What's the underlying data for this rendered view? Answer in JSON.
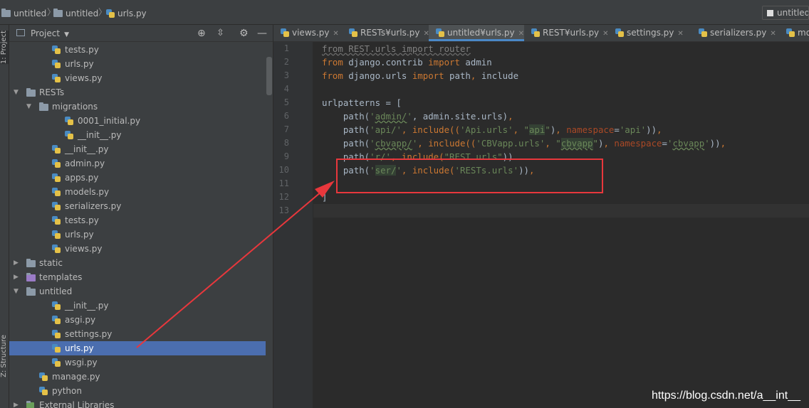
{
  "navbar": {
    "crumbs": [
      "untitled",
      "untitled",
      "urls.py"
    ],
    "run_config": "untitled"
  },
  "toolstrip": {
    "project_tab": "1: Project",
    "structure_tab": "Z: Structure"
  },
  "project_panel": {
    "title": "Project",
    "tree": [
      {
        "label": "tests.py",
        "type": "py"
      },
      {
        "label": "urls.py",
        "type": "py"
      },
      {
        "label": "views.py",
        "type": "py"
      },
      {
        "label": "RESTs",
        "type": "folder",
        "expanded": true
      },
      {
        "label": "migrations",
        "type": "folder",
        "expanded": true
      },
      {
        "label": "0001_initial.py",
        "type": "py"
      },
      {
        "label": "__init__.py",
        "type": "py"
      },
      {
        "label": "__init__.py",
        "type": "py"
      },
      {
        "label": "admin.py",
        "type": "py"
      },
      {
        "label": "apps.py",
        "type": "py"
      },
      {
        "label": "models.py",
        "type": "py"
      },
      {
        "label": "serializers.py",
        "type": "py"
      },
      {
        "label": "tests.py",
        "type": "py"
      },
      {
        "label": "urls.py",
        "type": "py"
      },
      {
        "label": "views.py",
        "type": "py"
      },
      {
        "label": "static",
        "type": "folder",
        "expanded": false
      },
      {
        "label": "templates",
        "type": "folder-purple",
        "expanded": false
      },
      {
        "label": "untitled",
        "type": "folder",
        "expanded": true
      },
      {
        "label": "__init__.py",
        "type": "py"
      },
      {
        "label": "asgi.py",
        "type": "py"
      },
      {
        "label": "settings.py",
        "type": "py"
      },
      {
        "label": "urls.py",
        "type": "py",
        "selected": true
      },
      {
        "label": "wsgi.py",
        "type": "py"
      },
      {
        "label": "manage.py",
        "type": "py"
      },
      {
        "label": "python",
        "type": "py"
      },
      {
        "label": "External Libraries",
        "type": "lib"
      }
    ]
  },
  "tabs": [
    {
      "label": "views.py"
    },
    {
      "label": "RESTs¥urls.py"
    },
    {
      "label": "untitled¥urls.py",
      "active": true
    },
    {
      "label": "REST¥urls.py"
    },
    {
      "label": "settings.py"
    },
    {
      "label": "serializers.py"
    },
    {
      "label": "mode"
    }
  ],
  "editor": {
    "line_numbers": [
      "1",
      "2",
      "3",
      "4",
      "5",
      "6",
      "7",
      "8",
      "9",
      "10",
      "11",
      "12",
      "13"
    ],
    "code": {
      "l1": {
        "a": "from REST.urls import router"
      },
      "l2": {
        "kw1": "from",
        "m": " django.contrib ",
        "kw2": "import",
        "n": " admin"
      },
      "l3": {
        "kw1": "from",
        "m": " django.urls ",
        "kw2": "import",
        "n": " path",
        "c": ",",
        "n2": " include"
      },
      "l5": {
        "t": "urlpatterns = ["
      },
      "l6": {
        "a": "    path(",
        "s1": "'",
        "s2": "admin/",
        "s3": "'",
        "b": ", admin.site.urls)",
        "c": ","
      },
      "l7": {
        "a": "    path(",
        "s1": "'api/'",
        "b": ", include((",
        "s2": "'Api.urls'",
        "c": ", ",
        "s3": "\"",
        "s4": "api",
        "s5": "\"",
        "d": ")",
        "e": ", ",
        "k": "namespace",
        "f": "=",
        "s6": "'api'",
        "g": "))",
        "h": ","
      },
      "l8": {
        "a": "    path(",
        "s1": "'",
        "s2": "cbvapp/",
        "s3": "'",
        "b": ", include((",
        "s4": "'CBVapp.urls'",
        "c": ", ",
        "s5": "\"",
        "s6": "cbvapp",
        "s7": "\"",
        "d": ")",
        "e": ", ",
        "k": "namespace",
        "f": "=",
        "s8": "'",
        "s9": "cbvapp",
        "s10": "'",
        "g": "))",
        "h": ","
      },
      "l9": {
        "a": "    path(",
        "s1": "'r/'",
        "b": ", include(",
        "s2": "\"REST.urls\"",
        "c": "))"
      },
      "l10": {
        "a": "    path(",
        "s1": "'",
        "s2": "ser/",
        "s3": "'",
        "b": ", include(",
        "s4": "'RESTs.urls'",
        "c": "))",
        "d": ","
      },
      "l12": {
        "t": "]"
      }
    }
  },
  "watermark": "https://blog.csdn.net/a__int__",
  "colors": {
    "annotation_red": "#e8373c",
    "selection": "#4b6eaf",
    "keyword": "#cc7832",
    "string": "#6a8759",
    "param": "#aa4926"
  }
}
